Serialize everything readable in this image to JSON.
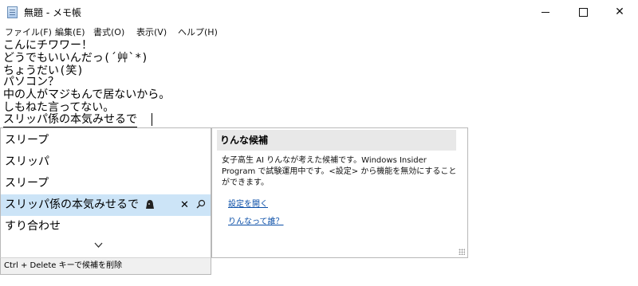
{
  "window": {
    "title": "無題 - メモ帳",
    "icon": "notepad-icon",
    "controls": {
      "minimize": "—",
      "maximize": "☐",
      "close": "✕"
    }
  },
  "menu": [
    "ファイル(F)",
    "編集(E)",
    "書式(O)",
    "表示(V)",
    "ヘルプ(H)"
  ],
  "editor": {
    "lines": [
      "こんにチワワー！",
      "どうでもいいんだっ(´艸`*)",
      "ちょうだい(笑)",
      "パソコン？",
      "中の人がマジもんで居ないから。",
      "しもねた言ってない。",
      "スリッパ係の本気みせるで"
    ]
  },
  "suggestions": {
    "items": [
      "スリープ",
      "スリッパ",
      "スリープ",
      "スリッパ係の本気みせるで",
      "すり合わせ"
    ],
    "selected_index": 3,
    "selected_icons": {
      "close": "✕",
      "search": "⚲"
    },
    "footer": "Ctrl + Delete キーで候補を削除"
  },
  "panel": {
    "header": "りんな候補",
    "description": "女子高生 AI りんなが考えた候補です。Windows Insider Program で試験運用中です。<設定> から機能を無効にすることができます。",
    "links": [
      "設定を開く",
      "りんなって誰？"
    ]
  }
}
